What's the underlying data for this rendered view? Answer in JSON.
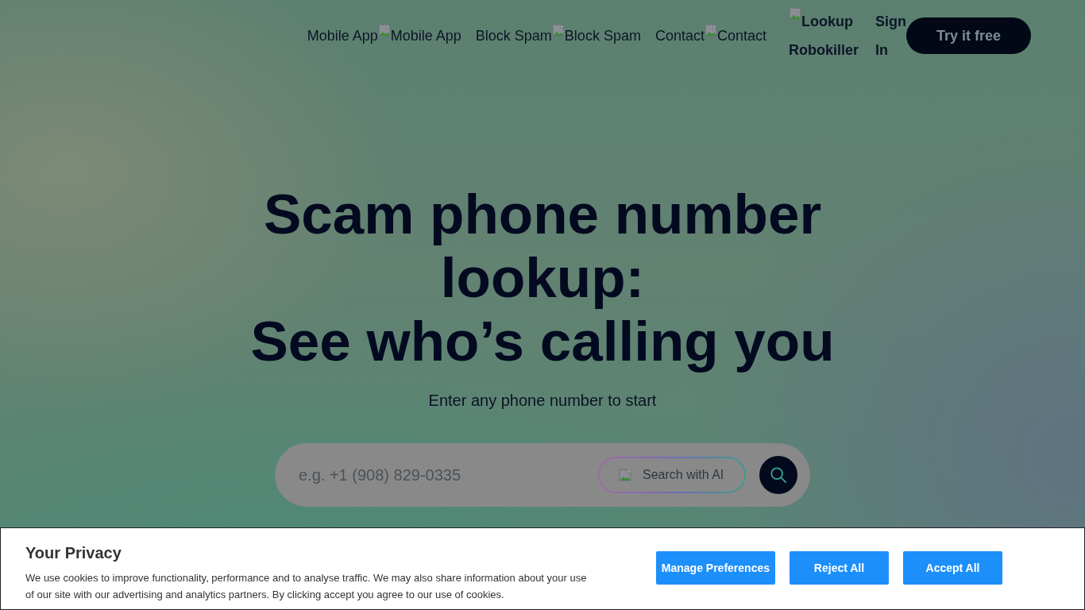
{
  "nav": {
    "links": [
      {
        "label": "Mobile App",
        "image_alt": "Mobile App"
      },
      {
        "label": "Block Spam",
        "image_alt": "Block Spam"
      },
      {
        "label": "Contact",
        "image_alt": "Contact"
      }
    ],
    "logo": {
      "image_alt": "Lookup Robokiller"
    },
    "sign_in": "Sign In",
    "cta": "Try it free"
  },
  "hero": {
    "title": "Scam phone number lookup:",
    "title_second_line": "See who’s calling you",
    "subtitle": "Enter any phone number to start"
  },
  "search": {
    "placeholder": "e.g. +1 (908) 829-0335",
    "ai_button": "Search with AI"
  },
  "cookie_banner": {
    "title": "Your Privacy",
    "text": "We use cookies to improve functionality, performance and to analyse traffic. We may also share information about your use of our site with our advertising and analytics partners. By clicking accept you agree to our use of cookies.",
    "buttons": [
      "Manage Preferences",
      "Reject All",
      "Accept All"
    ]
  }
}
